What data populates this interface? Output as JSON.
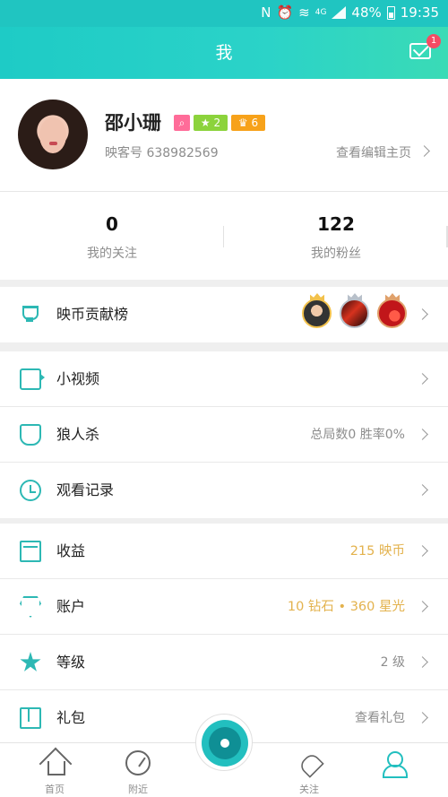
{
  "status_bar": {
    "battery": "48%",
    "network": "4G",
    "time": "19:35"
  },
  "header": {
    "title": "我",
    "unread_count": "1"
  },
  "profile": {
    "name": "邵小珊",
    "star_level": "2",
    "crown_level": "6",
    "id_label": "映客号",
    "id_value": "638982569",
    "view_page": "查看编辑主页"
  },
  "stats": {
    "following_count": "0",
    "following_label": "我的关注",
    "fans_count": "122",
    "fans_label": "我的粉丝"
  },
  "menu_rank": {
    "label": "映币贡献榜"
  },
  "menu_group_1": [
    {
      "label": "小视频",
      "value": ""
    },
    {
      "label": "狼人杀",
      "value": "总局数0 胜率0%"
    },
    {
      "label": "观看记录",
      "value": ""
    }
  ],
  "menu_group_2": [
    {
      "label": "收益",
      "value": "215 映币"
    },
    {
      "label": "账户",
      "value": "10 钻石 • 360 星光"
    },
    {
      "label": "等级",
      "value": "2 级"
    },
    {
      "label": "礼包",
      "value": "查看礼包"
    }
  ],
  "tabbar": {
    "home": "首页",
    "nearby": "附近",
    "follow": "关注"
  },
  "colors": {
    "accent": "#22bfbf",
    "gold_text": "#e3b24d",
    "badge": "#f54b64"
  }
}
